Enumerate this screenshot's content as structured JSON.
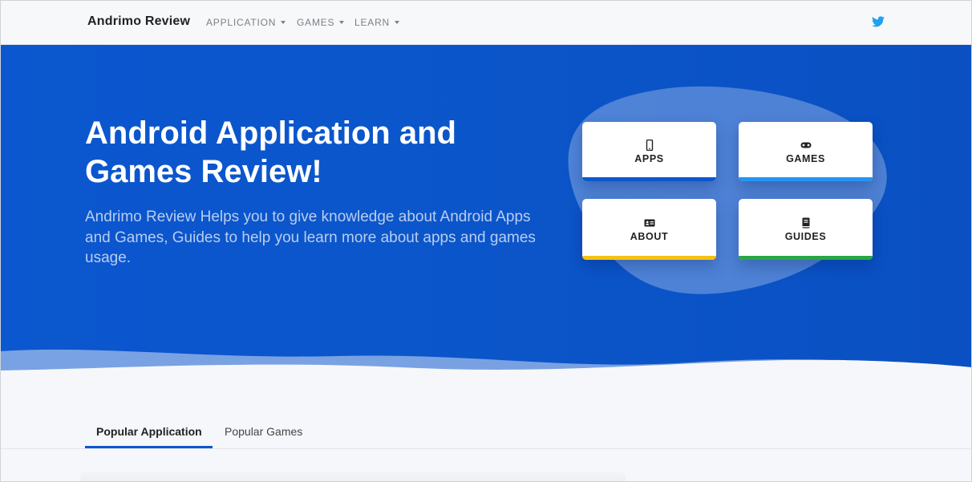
{
  "navbar": {
    "brand": "Andrimo Review",
    "items": [
      {
        "label": "APPLICATION"
      },
      {
        "label": "GAMES"
      },
      {
        "label": "LEARN"
      }
    ],
    "social_icon": "twitter-icon"
  },
  "hero": {
    "title": "Android Application and Games Review!",
    "description": "Andrimo Review Helps you to give knowledge about Android Apps and Games, Guides to help you learn more about apps and games usage."
  },
  "cards": [
    {
      "label": "APPS",
      "icon": "phone-icon",
      "accent": "#0b57cf"
    },
    {
      "label": "GAMES",
      "icon": "gamepad-icon",
      "accent": "#2196f3"
    },
    {
      "label": "ABOUT",
      "icon": "id-card-icon",
      "accent": "#f5c211"
    },
    {
      "label": "GUIDES",
      "icon": "book-icon",
      "accent": "#28a745"
    }
  ],
  "tabs": [
    {
      "label": "Popular Application",
      "active": true
    },
    {
      "label": "Popular Games",
      "active": false
    }
  ],
  "colors": {
    "primary": "#0b57cf",
    "twitter": "#1da1f2"
  }
}
